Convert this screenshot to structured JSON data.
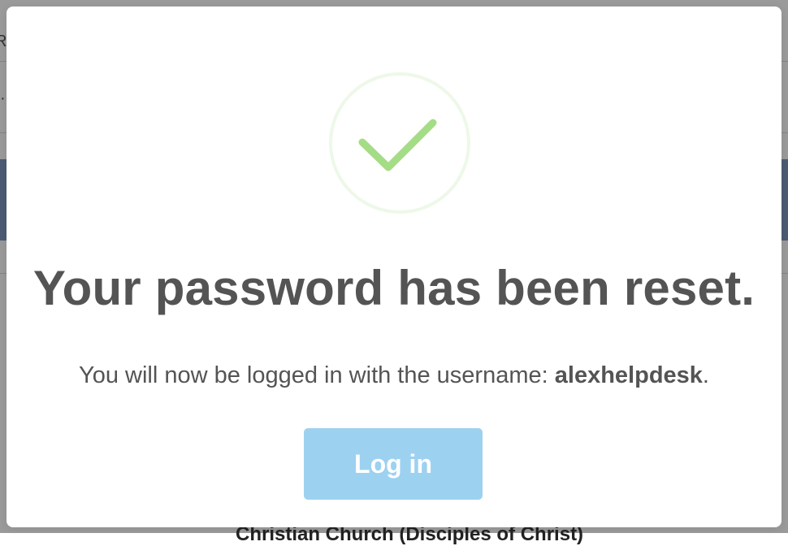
{
  "background": {
    "partial_left_top": "R",
    "partial_left_mid": "·",
    "partial_bottom": "Christian Church (Disciples of Christ)"
  },
  "modal": {
    "icon": "checkmark-circle-icon",
    "icon_color": "#a5dc86",
    "title": "Your password has been reset.",
    "message_prefix": "You will now be logged in with the username: ",
    "username": "alexhelpdesk",
    "message_suffix": ".",
    "button_label": "Log in",
    "button_color": "#9dd1f0"
  }
}
